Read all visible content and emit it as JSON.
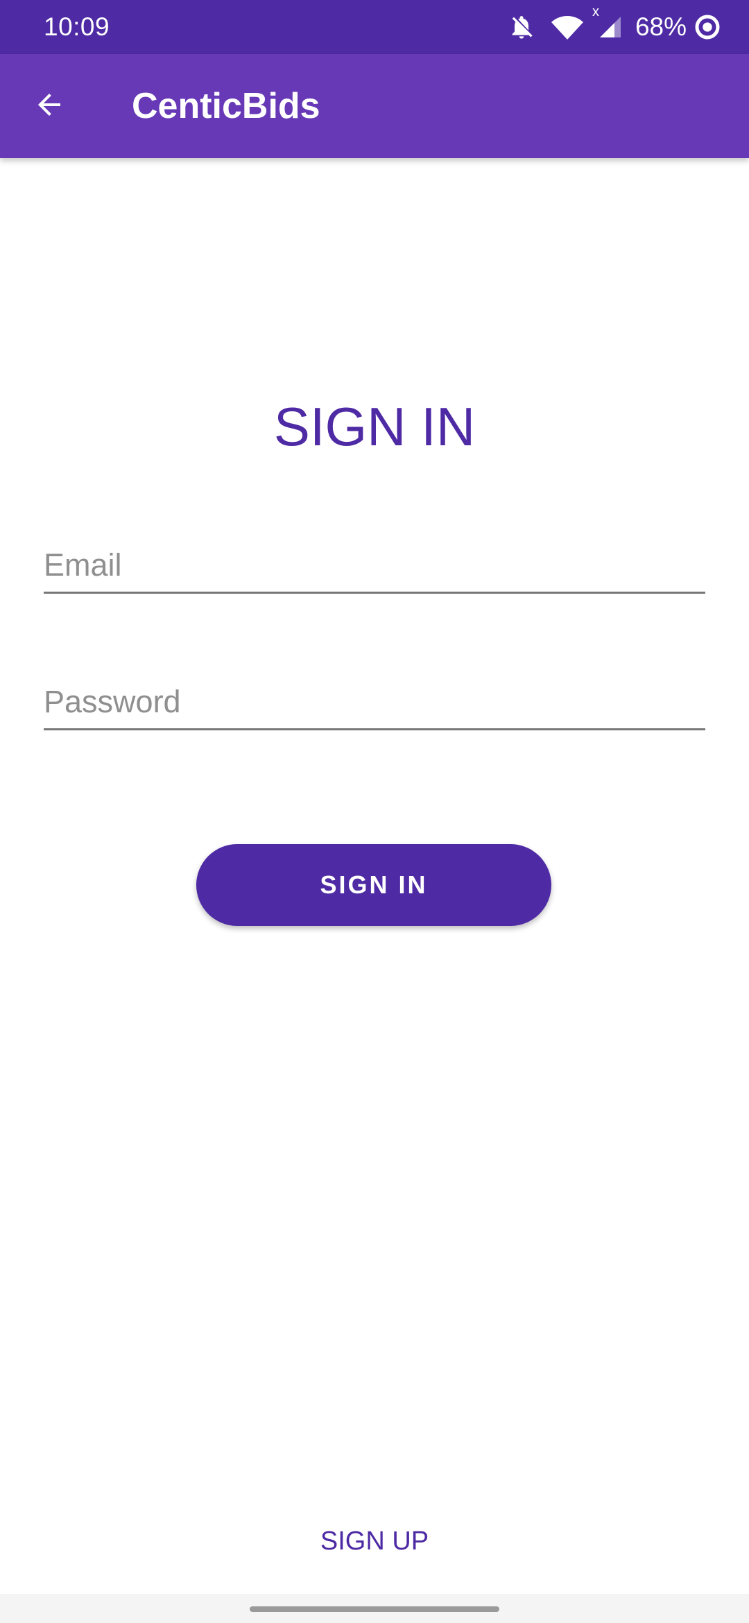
{
  "status_bar": {
    "time": "10:09",
    "signal_badge": "x",
    "battery_percent": "68%",
    "icons": [
      "notifications-off-icon",
      "wifi-icon",
      "cell-signal-icon",
      "battery-saver-icon"
    ]
  },
  "app_bar": {
    "title": "CenticBids",
    "back_icon": "arrow-back-icon"
  },
  "main": {
    "heading": "SIGN IN",
    "email_placeholder": "Email",
    "password_placeholder": "Password",
    "signin_button_label": "SIGN IN",
    "signup_link_label": "SIGN UP"
  },
  "colors": {
    "status_bar": "#4e2aa4",
    "app_bar": "#6739b7",
    "accent": "#4e2aa4",
    "background": "#ffffff"
  }
}
